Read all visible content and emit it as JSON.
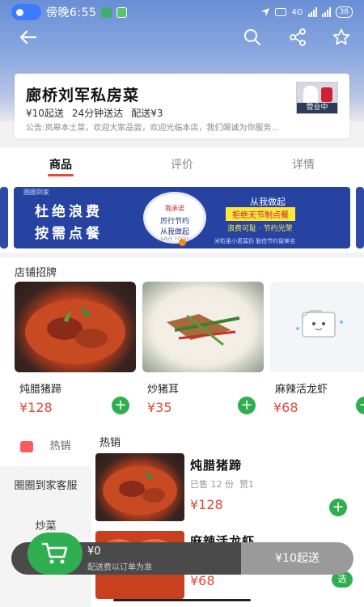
{
  "status_bar": {
    "time": "傍晚6:55",
    "network": "4G",
    "battery": "38"
  },
  "store": {
    "name": "廊桥刘军私房菜",
    "min_order": "¥10起送",
    "delivery_time": "24分钟送达",
    "delivery_fee": "配送¥3",
    "notice": "公告:岚皋本土菜，欢迎大家品尝，欢迎光临本店，我们竭诚为你服务...",
    "status": "营业中"
  },
  "tabs": [
    {
      "label": "商品",
      "active": true
    },
    {
      "label": "评价",
      "active": false
    },
    {
      "label": "详情",
      "active": false
    }
  ],
  "banner": {
    "brand": "圈圈到家",
    "line1": "杜绝浪费",
    "line2": "按需点餐",
    "badge_top": "我承诺",
    "badge_mid": "厉行节约",
    "badge_bot": "从我做起",
    "badge_small": "SAVE FOOD",
    "right_1": "从我做起",
    "right_2": "拒绝无节制点餐",
    "right_3": "浪费可耻 · 节约光荣",
    "right_4": "米粒虽小君莫扔 勤俭节约留美名"
  },
  "signature": {
    "title": "店铺招牌",
    "items": [
      {
        "name": "炖腊猪蹄",
        "price": "¥128"
      },
      {
        "name": "炒猪耳",
        "price": "¥35"
      },
      {
        "name": "麻辣活龙虾",
        "price": "¥68"
      }
    ]
  },
  "categories": [
    {
      "label": "热销",
      "active": true
    },
    {
      "label": "圈圈到家客服",
      "active": false
    },
    {
      "label": "炒菜",
      "active": false
    }
  ],
  "products": {
    "section": "热销",
    "items": [
      {
        "name": "炖腊猪蹄",
        "sold": "已售 12 份",
        "likes": "赞1",
        "price": "¥128"
      },
      {
        "name": "麻辣活龙虾",
        "price": "¥68",
        "action": "选"
      }
    ]
  },
  "cart": {
    "total": "¥0",
    "note": "配送费以订单为准",
    "checkout": "¥10起送"
  },
  "colors": {
    "accent_red": "#e24a3b",
    "green": "#2fae50",
    "banner_blue": "#2643a2"
  }
}
